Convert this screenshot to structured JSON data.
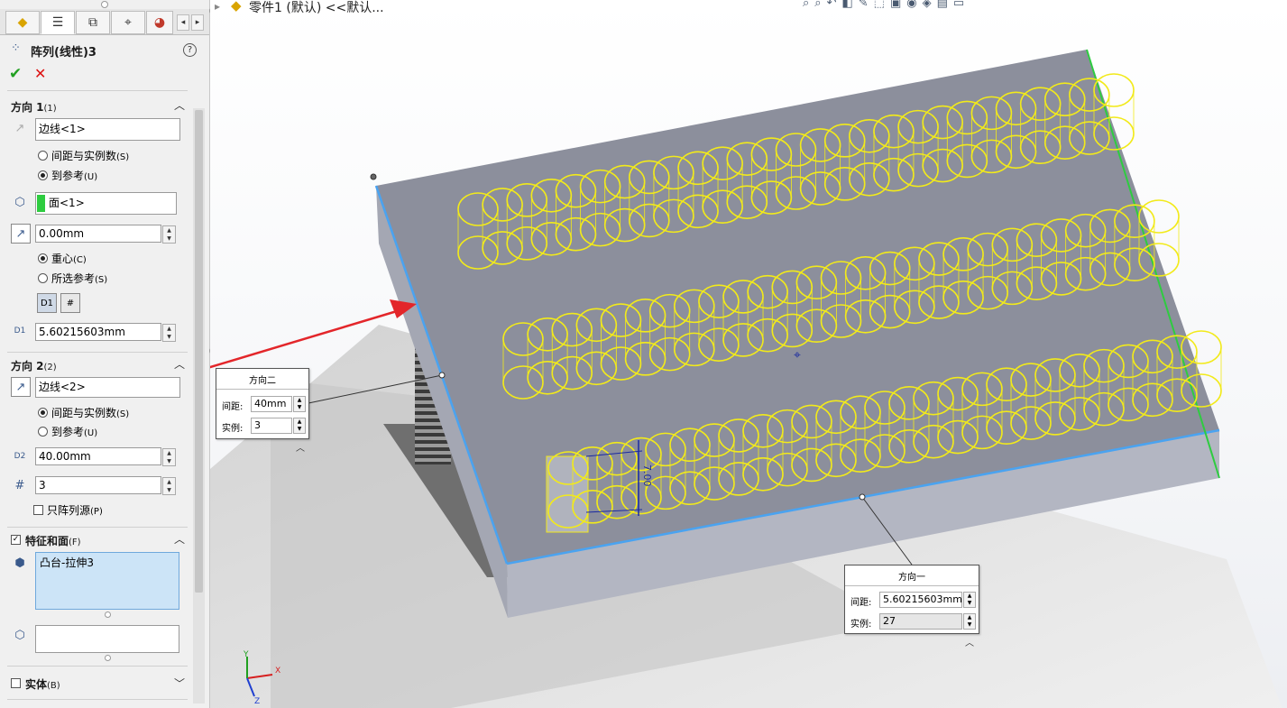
{
  "window": {
    "doc_title": "零件1 (默认) <<默认..."
  },
  "tabs": [
    {
      "icon": "feature-manager-icon"
    },
    {
      "icon": "property-manager-icon"
    },
    {
      "icon": "configuration-manager-icon"
    },
    {
      "icon": "dimxpert-icon"
    },
    {
      "icon": "display-manager-icon"
    }
  ],
  "pm": {
    "title": "阵列(线性)3",
    "help": "?",
    "ok_glyph": "✔",
    "cancel_glyph": "✕"
  },
  "dir1": {
    "header": "方向 1",
    "header_key": "(1)",
    "edge_value": "边线<1>",
    "opt_spacing": "间距与实例数",
    "opt_spacing_key": "(S)",
    "opt_ref": "到参考",
    "opt_ref_key": "(U)",
    "ref_selected": "to-reference",
    "face_value": "面<1>",
    "offset_value": "0.00mm",
    "opt_centroid": "重心",
    "opt_centroid_key": "(C)",
    "opt_selected_ref": "所选参考",
    "opt_selected_ref_key": "(S)",
    "centroid_selected": true,
    "spacing_value": "5.60215603mm"
  },
  "dir2": {
    "header": "方向 2",
    "header_key": "(2)",
    "edge_value": "边线<2>",
    "opt_spacing": "间距与实例数",
    "opt_spacing_key": "(S)",
    "opt_ref": "到参考",
    "opt_ref_key": "(U)",
    "spacing_selected": true,
    "spacing_value": "40.00mm",
    "instances_value": "3",
    "only_seed_label": "只阵列源",
    "only_seed_key": "(P)",
    "only_seed_checked": false
  },
  "features": {
    "header": "特征和面",
    "header_key": "(F)",
    "checked": true,
    "items": [
      "凸台-拉伸3"
    ]
  },
  "bodies": {
    "header": "实体",
    "header_key": "(B)",
    "checked": false
  },
  "callout_dir2": {
    "title": "方向二",
    "spacing_label": "间距:",
    "spacing_value": "40mm",
    "instances_label": "实例:",
    "instances_value": "3"
  },
  "callout_dir1": {
    "title": "方向一",
    "spacing_label": "间距:",
    "spacing_value": "5.60215603mm",
    "instances_label": "实例:",
    "instances_value": "27"
  },
  "dimension_label": "7.00",
  "triad": {
    "x": "X",
    "y": "Y",
    "z": "Z"
  },
  "colors": {
    "selection_blue": "#4aa3f0",
    "edge_green": "#2ecc40",
    "preview_yellow": "#f2ea1a",
    "arrow_red": "#e3262a",
    "plate_top": "#8c8f9c"
  }
}
